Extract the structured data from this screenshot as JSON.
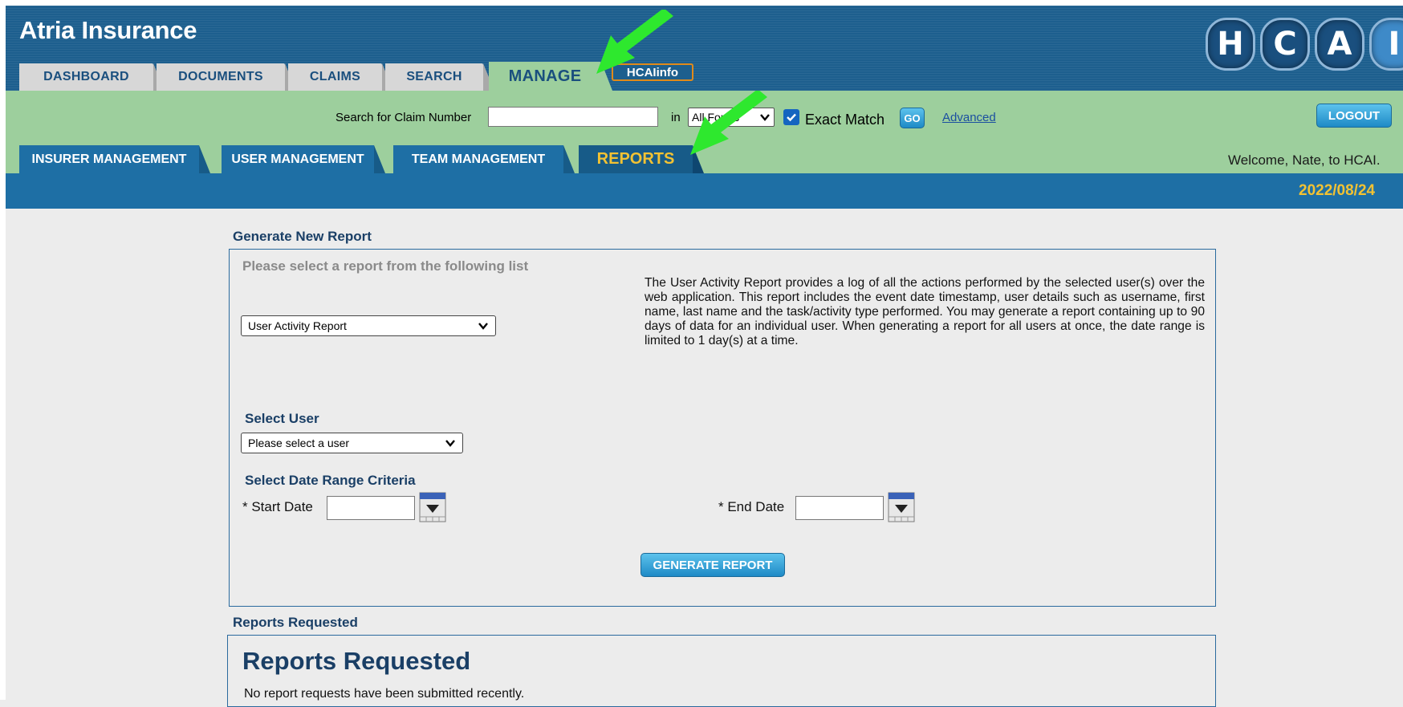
{
  "app": {
    "title": "Atria Insurance",
    "logo_letters": [
      "H",
      "C",
      "A",
      "I"
    ]
  },
  "main_tabs": [
    {
      "label": "DASHBOARD"
    },
    {
      "label": "DOCUMENTS"
    },
    {
      "label": "CLAIMS"
    },
    {
      "label": "SEARCH"
    },
    {
      "label": "MANAGE",
      "active": true
    }
  ],
  "hcainfo_label": "HCAIinfo",
  "search": {
    "label": "Search for Claim Number",
    "value": "",
    "in_label": "in",
    "scope_value": "All Forms",
    "exact_match_checked": true,
    "exact_match_label": "Exact Match",
    "go_label": "GO",
    "advanced_label": "Advanced"
  },
  "logout_label": "LOGOUT",
  "sub_tabs": [
    {
      "label": "INSURER MANAGEMENT"
    },
    {
      "label": "USER MANAGEMENT"
    },
    {
      "label": "TEAM MANAGEMENT"
    },
    {
      "label": "REPORTS",
      "active": true
    }
  ],
  "welcome_text": "Welcome, Nate, to HCAI.",
  "date": "2022/08/24",
  "generate": {
    "section_title": "Generate New Report",
    "hint": "Please select a report from the following list",
    "report_select_value": "User Activity Report",
    "description": "The User Activity Report provides a log of all the actions performed by the selected user(s) over the web application. This report includes the event date timestamp, user details such as username, first name, last name and the task/activity type performed. You may generate a report containing up to 90 days of data for an individual user. When generating a report for all users at once, the date range is limited to 1 day(s) at a time.",
    "select_user_label": "Select User",
    "user_select_value": "Please select a user",
    "date_range_label": "Select Date Range Criteria",
    "start_date_label": "* Start Date",
    "start_date_value": "",
    "end_date_label": "* End Date",
    "end_date_value": "",
    "button_label": "GENERATE REPORT"
  },
  "requested": {
    "section_title": "Reports Requested",
    "heading": "Reports Requested",
    "empty_text": "No report requests have been submitted recently."
  },
  "colors": {
    "header_blue": "#1d5f8e",
    "manage_green": "#9dcf9d",
    "sub_tab_blue": "#1e6fa5",
    "accent_yellow": "#f2c233",
    "annotation_arrow": "#2ee82e"
  }
}
